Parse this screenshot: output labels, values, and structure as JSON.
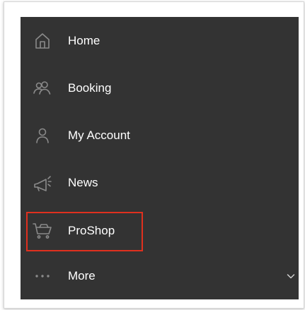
{
  "colors": {
    "menu_bg": "#333333",
    "text": "#ffffff",
    "icon": "#8a8a8a",
    "highlight": "#e0301e"
  },
  "menu": {
    "items": [
      {
        "label": "Home",
        "icon": "home-icon"
      },
      {
        "label": "Booking",
        "icon": "users-icon"
      },
      {
        "label": "My Account",
        "icon": "user-icon"
      },
      {
        "label": "News",
        "icon": "megaphone-icon"
      },
      {
        "label": "ProShop",
        "icon": "shopping-cart-icon",
        "highlighted": true
      },
      {
        "label": "More",
        "icon": "ellipsis-icon",
        "expandable": true
      }
    ]
  }
}
